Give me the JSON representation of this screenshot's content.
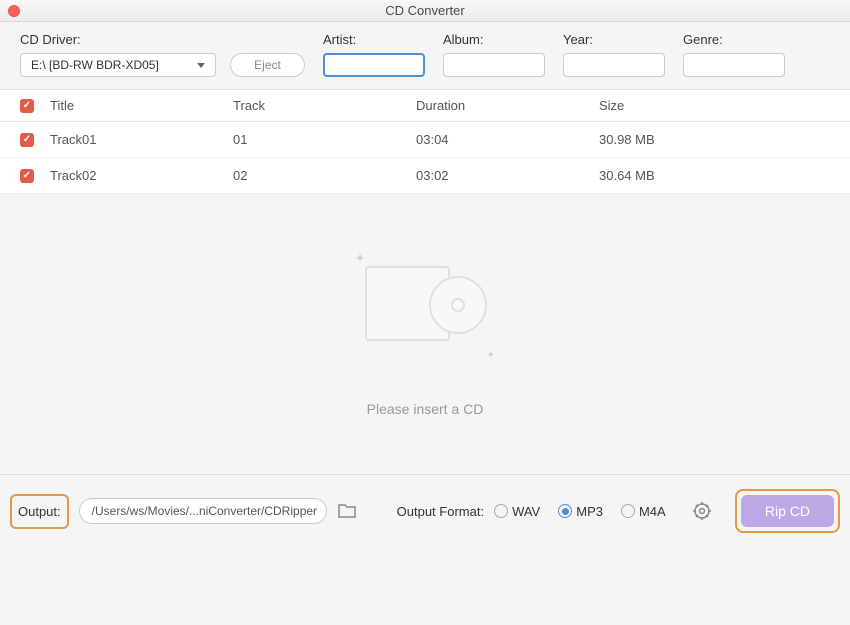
{
  "window": {
    "title": "CD Converter"
  },
  "form": {
    "driver_label": "CD Driver:",
    "driver_value": "E:\\ [BD-RW   BDR-XD05]",
    "eject_label": "Eject",
    "artist_label": "Artist:",
    "artist_value": "",
    "album_label": "Album:",
    "album_value": "",
    "year_label": "Year:",
    "year_value": "",
    "genre_label": "Genre:",
    "genre_value": ""
  },
  "table": {
    "headers": {
      "title": "Title",
      "track": "Track",
      "duration": "Duration",
      "size": "Size"
    },
    "rows": [
      {
        "title": "Track01",
        "track": "01",
        "duration": "03:04",
        "size": "30.98 MB"
      },
      {
        "title": "Track02",
        "track": "02",
        "duration": "03:02",
        "size": "30.64 MB"
      }
    ]
  },
  "empty": {
    "message": "Please insert a CD"
  },
  "bottom": {
    "output_label": "Output:",
    "output_path": "/Users/ws/Movies/...niConverter/CDRipper",
    "format_label": "Output Format:",
    "formats": {
      "wav": "WAV",
      "mp3": "MP3",
      "m4a": "M4A"
    },
    "rip_label": "Rip CD"
  }
}
